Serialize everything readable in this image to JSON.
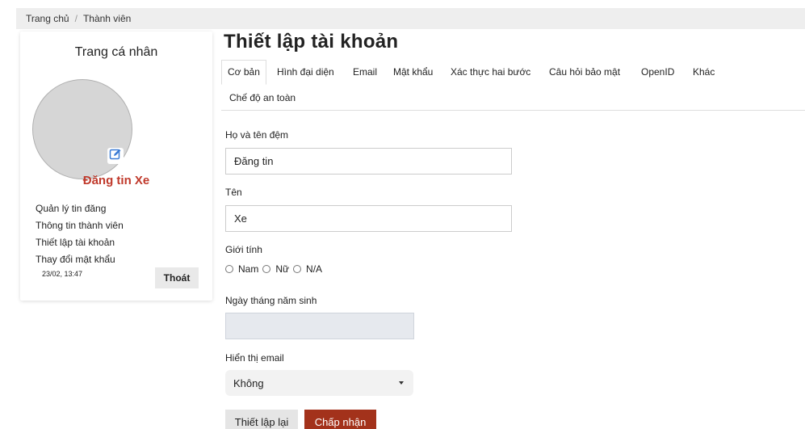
{
  "breadcrumb": {
    "home": "Trang chủ",
    "separator": "/",
    "current": "Thành viên"
  },
  "profile": {
    "title": "Trang cá nhân",
    "name": "Đăng tin Xe",
    "menu": [
      "Quản lý tin đăng",
      "Thông tin thành viên",
      "Thiết lập tài khoản",
      "Thay đổi mật khẩu"
    ],
    "last_time": "23/02, 13:47",
    "logout_label": "Thoát",
    "edit_icon": "edit-icon",
    "accent_color": "#c0392b"
  },
  "main": {
    "title": "Thiết lập tài khoản",
    "tabs": [
      {
        "label": "Cơ bản",
        "active": true
      },
      {
        "label": "Hình đại diện"
      },
      {
        "label": "Email"
      },
      {
        "label": "Mật khẩu"
      },
      {
        "label": "Xác thực hai bước"
      },
      {
        "label": "Câu hỏi bảo mật"
      },
      {
        "label": "OpenID"
      },
      {
        "label": "Khác"
      },
      {
        "label": "Chế độ an toàn"
      }
    ]
  },
  "form": {
    "first_name_label": "Họ và tên đệm",
    "first_name_value": "Đăng tin",
    "last_name_label": "Tên",
    "last_name_value": "Xe",
    "gender_label": "Giới tính",
    "gender_options": [
      "Nam",
      "Nữ",
      "N/A"
    ],
    "birthday_label": "Ngày tháng năm sinh",
    "birthday_value": "",
    "show_email_label": "Hiển thị email",
    "show_email_value": "Không",
    "reset_label": "Thiết lập lại",
    "submit_label": "Chấp nhận",
    "submit_color": "#a3321b"
  }
}
